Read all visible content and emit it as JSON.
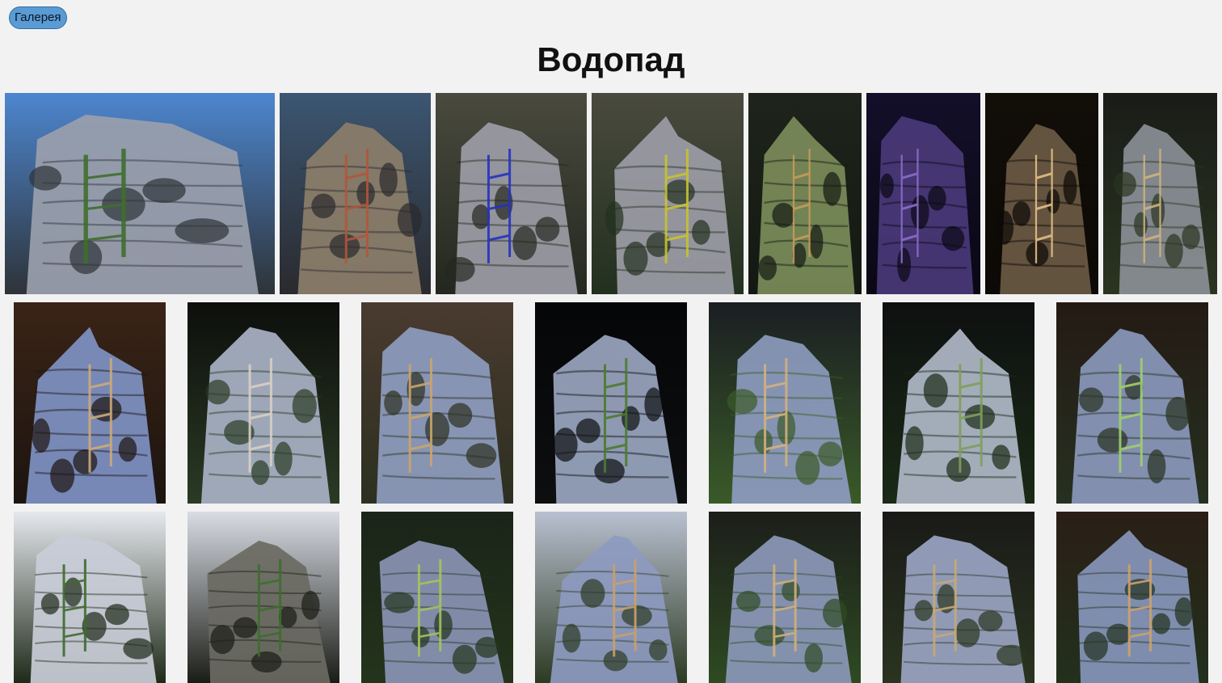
{
  "nav": {
    "back_label": "Галерея"
  },
  "page": {
    "title": "Водопад"
  },
  "gallery": {
    "rows": [
      {
        "photos": [
          {
            "sky": "#4d86cf",
            "rock": "#9aa0ac",
            "accent": "#3f6e2c",
            "shade": "#2e3338"
          },
          {
            "sky": "#3c5672",
            "rock": "#8c7e6a",
            "accent": "#b0553a",
            "shade": "#2a2a2e"
          },
          {
            "sky": "#4a4a3e",
            "rock": "#9c9ca6",
            "accent": "#2332c0",
            "shade": "#23281f"
          },
          {
            "sky": "#4a4a3e",
            "rock": "#9c9ca6",
            "accent": "#c7c22f",
            "shade": "#22301f"
          },
          {
            "sky": "#1e241c",
            "rock": "#7b8c5a",
            "accent": "#c89a5a",
            "shade": "#141812"
          },
          {
            "sky": "#130f2a",
            "rock": "#4a3a7a",
            "accent": "#8c6cc8",
            "shade": "#0a0814"
          },
          {
            "sky": "#120e08",
            "rock": "#6a5a44",
            "accent": "#e2bf86",
            "shade": "#0c0906"
          },
          {
            "sky": "#1a1c18",
            "rock": "#8a8f96",
            "accent": "#d1b27a",
            "shade": "#2a3520"
          }
        ]
      },
      {
        "photos": [
          {
            "sky": "#3a2416",
            "rock": "#7f93c4",
            "accent": "#cdaa78",
            "shade": "#1c1410"
          },
          {
            "sky": "#0d0f0c",
            "rock": "#a9b2c6",
            "accent": "#d8cfc4",
            "shade": "#2a3a24"
          },
          {
            "sky": "#4a3a30",
            "rock": "#8e9cbf",
            "accent": "#caa46c",
            "shade": "#2c3020"
          },
          {
            "sky": "#050608",
            "rock": "#9aa6c0",
            "accent": "#4c7a2e",
            "shade": "#0d0e10"
          },
          {
            "sky": "#1a1e22",
            "rock": "#8d9bbf",
            "accent": "#d2b07e",
            "shade": "#3a5a28"
          },
          {
            "sky": "#0e1010",
            "rock": "#b0b8c8",
            "accent": "#7da05a",
            "shade": "#1a2a16"
          },
          {
            "sky": "#241a14",
            "rock": "#8a98bc",
            "accent": "#9fcf6a",
            "shade": "#263020"
          }
        ]
      },
      {
        "photos": [
          {
            "sky": "#e6e8ee",
            "rock": "#c9cdd8",
            "accent": "#3e6a2e",
            "shade": "#1e2a18"
          },
          {
            "sky": "#d9dce4",
            "rock": "#6a6a62",
            "accent": "#3c6e2c",
            "shade": "#1a1c16"
          },
          {
            "sky": "#1a2418",
            "rock": "#8a94b4",
            "accent": "#a6c25a",
            "shade": "#24341c"
          },
          {
            "sky": "#b8c0d0",
            "rock": "#8d9ac0",
            "accent": "#caa06a",
            "shade": "#2c3a22"
          },
          {
            "sky": "#1c1e1a",
            "rock": "#8c98ba",
            "accent": "#d0b07a",
            "shade": "#2e4a22"
          },
          {
            "sky": "#1a1a18",
            "rock": "#9aa4c2",
            "accent": "#c8a872",
            "shade": "#2a3420"
          },
          {
            "sky": "#2a1e16",
            "rock": "#8796bb",
            "accent": "#cda26a",
            "shade": "#22301c"
          }
        ]
      }
    ]
  }
}
